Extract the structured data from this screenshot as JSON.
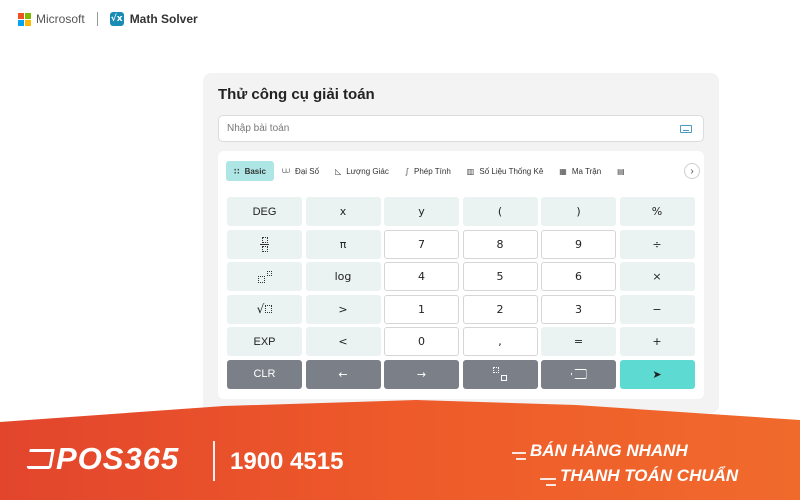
{
  "header": {
    "brand": "Microsoft",
    "app_icon": "math-solver-icon",
    "app_name": "Math Solver",
    "logo_colors": [
      "#f25022",
      "#7fba00",
      "#00a4ef",
      "#ffb900"
    ]
  },
  "panel": {
    "title": "Thử công cụ giải toán",
    "search_placeholder": "Nhập bài toán",
    "tabs": [
      {
        "icon": "basic-icon",
        "glyph": "∷",
        "label": "Basic",
        "active": true
      },
      {
        "icon": "algebra-icon",
        "glyph": "⩊",
        "label": "Đại Số",
        "active": false
      },
      {
        "icon": "trigonometry-icon",
        "glyph": "◺",
        "label": "Lượng Giác",
        "active": false
      },
      {
        "icon": "calculus-icon",
        "glyph": "∫",
        "label": "Phép Tính",
        "active": false
      },
      {
        "icon": "statistics-icon",
        "glyph": "▥",
        "label": "Số Liệu Thống Kê",
        "active": false
      },
      {
        "icon": "matrix-icon",
        "glyph": "▦",
        "label": "Ma Trận",
        "active": false
      },
      {
        "icon": "more-icon",
        "glyph": "▤",
        "label": "",
        "active": false
      }
    ],
    "keys": {
      "deg": "DEG",
      "x": "x",
      "y": "y",
      "lparen": "(",
      "rparen": ")",
      "percent": "%",
      "pi": "π",
      "seven": "7",
      "eight": "8",
      "nine": "9",
      "divide": "÷",
      "log": "log",
      "four": "4",
      "five": "5",
      "six": "6",
      "multiply": "×",
      "gt": ">",
      "one": "1",
      "two": "2",
      "three": "3",
      "minus": "−",
      "exp": "EXP",
      "lt": "<",
      "zero": "0",
      "comma": ",",
      "equals": "=",
      "plus": "+",
      "clr": "CLR",
      "left": "←",
      "right": "→",
      "submit": "➤"
    }
  },
  "banner": {
    "brand": "POS365",
    "hotline": "1900 4515",
    "slogan_line1": "BÁN HÀNG NHANH",
    "slogan_line2": "THANH TOÁN CHUẨN",
    "accent": "#ee5a2a"
  }
}
